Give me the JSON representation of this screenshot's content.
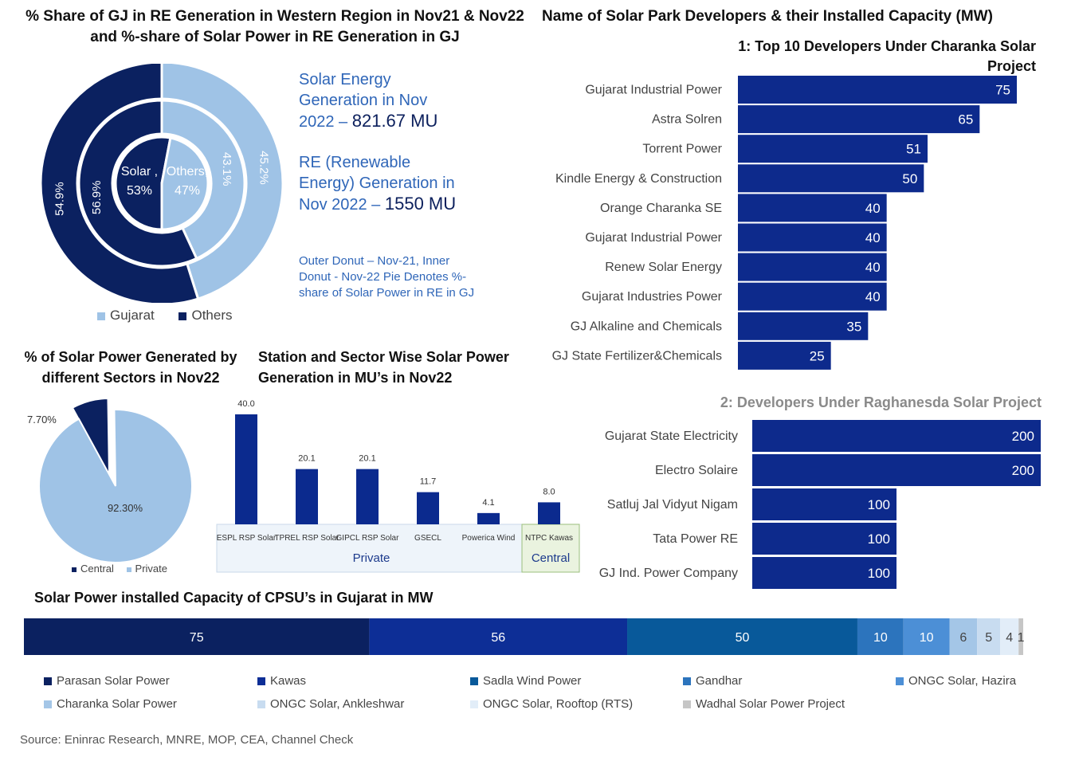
{
  "colors": {
    "navy": "#0b2160",
    "light_blue": "#9fc3e6",
    "bar_blue": "#0d2a8c",
    "text_blue": "#2f66b8"
  },
  "section1": {
    "title": "% Share of GJ in RE Generation in Western Region in Nov21 & Nov22 and %-share of Solar Power in RE Generation in GJ",
    "outer_labels": {
      "gujarat": "45.2%",
      "others": "54.9%"
    },
    "inner_labels": {
      "gujarat": "43.1%",
      "others": "56.9%"
    },
    "pie_labels": {
      "solar": "Solar ,",
      "solar_value": "53%",
      "others": "Others,",
      "others_value": "47%"
    },
    "legend": {
      "gujarat": "Gujarat",
      "others": "Others"
    },
    "text1_prefix": "Solar Energy Generation in Nov 2022 –",
    "text1_value": "821.67 MU",
    "text2_prefix": "RE (Renewable Energy) Generation in Nov 2022 –",
    "text2_value": "1550 MU",
    "note": "Outer Donut – Nov-21, Inner Donut  -  Nov-22 Pie Denotes %-share of Solar Power in RE in GJ"
  },
  "section2": {
    "title": "% of Solar Power Generated by different Sectors in Nov22",
    "central_label": "7.70%",
    "private_label": "92.30%",
    "legend": {
      "central": "Central",
      "private": "Private"
    }
  },
  "section3": {
    "title": "Station and Sector Wise Solar Power Generation in MU’s in Nov22",
    "group_private": "Private",
    "group_central": "Central"
  },
  "section4": {
    "title": "Name of Solar Park Developers & their Installed Capacity (MW)",
    "subtitle1": "1: Top 10 Developers Under Charanka Solar Project",
    "subtitle2": "2: Developers Under Raghanesda Solar Project"
  },
  "section5": {
    "title": "Solar Power installed Capacity of CPSU’s in Gujarat in MW"
  },
  "source": "Source: Eninrac Research, MNRE, MOP, CEA, Channel Check",
  "chart_data": [
    {
      "type": "pie",
      "name": "outer donut Nov-21",
      "categories": [
        "Gujarat",
        "Others"
      ],
      "values": [
        45.2,
        54.9
      ]
    },
    {
      "type": "pie",
      "name": "inner donut Nov-22",
      "categories": [
        "Gujarat",
        "Others"
      ],
      "values": [
        43.1,
        56.9
      ]
    },
    {
      "type": "pie",
      "name": "solar share pie",
      "categories": [
        "Solar",
        "Others"
      ],
      "values": [
        53,
        47
      ]
    },
    {
      "type": "pie",
      "name": "sector pie",
      "categories": [
        "Central",
        "Private"
      ],
      "values": [
        7.7,
        92.3
      ]
    },
    {
      "type": "bar",
      "name": "station bars",
      "categories": [
        "ESPL RSP Solar",
        "TPREL RSP Solar",
        "GIPCL RSP Solar",
        "GSECL",
        "Powerica Wind",
        "NTPC Kawas"
      ],
      "values": [
        40.0,
        20.1,
        20.1,
        11.7,
        4.1,
        8.0
      ],
      "value_labels": [
        "40.0",
        "20.1",
        "20.1",
        "11.7",
        "4.1",
        "8.0"
      ],
      "groups": [
        "Private",
        "Private",
        "Private",
        "Private",
        "Private",
        "Central"
      ]
    },
    {
      "type": "bar",
      "name": "charanka",
      "orientation": "horizontal",
      "categories": [
        "Gujarat Industrial Power",
        "Astra Solren",
        "Torrent Power",
        "Kindle Energy & Construction",
        "Orange Charanka SE",
        "Gujarat Industrial Power",
        "Renew Solar Energy",
        "Gujarat Industries Power",
        "GJ Alkaline and Chemicals",
        "GJ State Fertilizer&Chemicals"
      ],
      "values": [
        75,
        65,
        51,
        50,
        40,
        40,
        40,
        40,
        35,
        25
      ]
    },
    {
      "type": "bar",
      "name": "raghanesda",
      "orientation": "horizontal",
      "categories": [
        "Gujarat State Electricity",
        "Electro Solaire",
        "Satluj Jal Vidyut Nigam",
        "Tata Power RE",
        "GJ Ind. Power Company"
      ],
      "values": [
        200,
        200,
        100,
        100,
        100
      ]
    },
    {
      "type": "bar",
      "name": "cpsu stacked",
      "orientation": "horizontal-stacked",
      "series": [
        {
          "name": "Parasan Solar Power",
          "value": 75,
          "color": "#0b2160"
        },
        {
          "name": "Kawas",
          "value": 56,
          "color": "#0d2e96"
        },
        {
          "name": "Sadla Wind Power",
          "value": 50,
          "color": "#08599a"
        },
        {
          "name": "Gandhar",
          "value": 10,
          "color": "#2c74bd"
        },
        {
          "name": "ONGC Solar, Hazira",
          "value": 10,
          "color": "#4c8fd6"
        },
        {
          "name": "Charanka Solar Power",
          "value": 6,
          "color": "#a4c6e7"
        },
        {
          "name": "ONGC Solar, Ankleshwar",
          "value": 5,
          "color": "#c8dcf0"
        },
        {
          "name": "ONGC Solar, Rooftop (RTS)",
          "value": 4,
          "color": "#e2edf8"
        },
        {
          "name": "Wadhal Solar Power Project",
          "value": 1,
          "color": "#c6c6c6"
        }
      ]
    }
  ]
}
